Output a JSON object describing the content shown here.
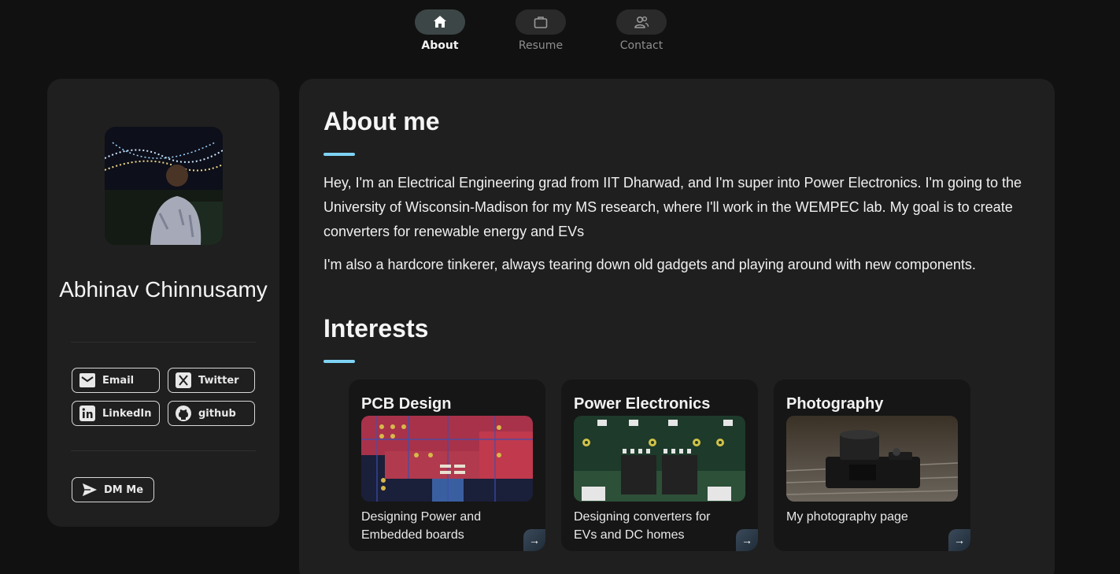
{
  "nav": {
    "items": [
      {
        "label": "About",
        "icon": "home-icon",
        "active": true
      },
      {
        "label": "Resume",
        "icon": "briefcase-icon",
        "active": false
      },
      {
        "label": "Contact",
        "icon": "people-icon",
        "active": false
      }
    ]
  },
  "profile": {
    "name": "Abhinav Chinnusamy",
    "links": {
      "email": "Email",
      "twitter": "Twitter",
      "linkedin": "LinkedIn",
      "github": "github",
      "dm": "DM Me"
    }
  },
  "about": {
    "title": "About me",
    "paragraphs": [
      "Hey, I'm an Electrical Engineering grad from IIT Dharwad, and I'm super into Power Electronics. I'm going to the University of Wisconsin-Madison for my MS research, where I'll work in the WEMPEC lab. My goal is to create converters for renewable energy and EVs",
      "I'm also a hardcore tinkerer, always tearing down old gadgets and playing around with new components."
    ]
  },
  "interests": {
    "title": "Interests",
    "cards": [
      {
        "title": "PCB Design",
        "description": "Designing Power and Embedded boards"
      },
      {
        "title": "Power Electronics",
        "description": "Designing converters for EVs and DC homes"
      },
      {
        "title": "Photography",
        "description": "My photography page"
      }
    ]
  },
  "colors": {
    "background": "#111111",
    "card": "#1f1f1f",
    "accent": "#7ed3f5"
  }
}
